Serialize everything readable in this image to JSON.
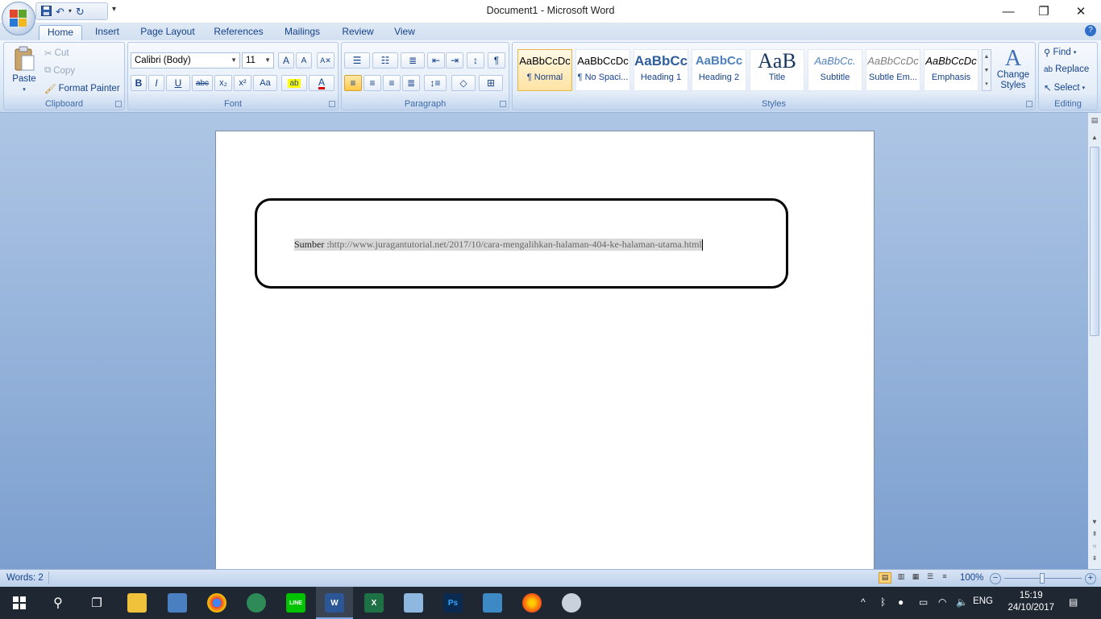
{
  "window": {
    "title": "Document1 - Microsoft Word",
    "minimize": "—",
    "restore": "❐",
    "close": "✕"
  },
  "qat": {
    "more": "▾"
  },
  "tabs": [
    "Home",
    "Insert",
    "Page Layout",
    "References",
    "Mailings",
    "Review",
    "View"
  ],
  "clipboard": {
    "label": "Clipboard",
    "paste": "Paste",
    "cut": "Cut",
    "copy": "Copy",
    "format_painter": "Format Painter"
  },
  "font": {
    "label": "Font",
    "family": "Calibri (Body)",
    "size": "11",
    "bold": "B",
    "italic": "I",
    "underline": "U",
    "strike": "abc",
    "subscript": "x₂",
    "superscript": "x²",
    "change_case": "Aa",
    "grow": "A",
    "shrink": "A"
  },
  "paragraph": {
    "label": "Paragraph",
    "show_marks": "¶"
  },
  "styles": {
    "label": "Styles",
    "items": [
      {
        "preview": "AaBbCcDc",
        "name": "¶ Normal"
      },
      {
        "preview": "AaBbCcDc",
        "name": "¶ No Spaci..."
      },
      {
        "preview": "AaBbCc",
        "name": "Heading 1"
      },
      {
        "preview": "AaBbCc",
        "name": "Heading 2"
      },
      {
        "preview": "AaB",
        "name": "Title"
      },
      {
        "preview": "AaBbCc.",
        "name": "Subtitle"
      },
      {
        "preview": "AaBbCcDc",
        "name": "Subtle Em..."
      },
      {
        "preview": "AaBbCcDc",
        "name": "Emphasis"
      }
    ],
    "change_styles": [
      "Change",
      "Styles"
    ]
  },
  "editing": {
    "label": "Editing",
    "find": "Find",
    "replace": "Replace",
    "select": "Select"
  },
  "document": {
    "prefix": "Sumber :",
    "link": "http://www.juragantutorial.net/2017/10/cara-mengalihkan-halaman-404-ke-halaman-utama.html"
  },
  "status": {
    "words": "Words: 2",
    "zoom": "100%"
  },
  "taskbar": {
    "lang": "ENG",
    "time": "15:19",
    "date": "24/10/2017"
  },
  "colors": {
    "accent": "#15428b",
    "ribbon_bg": "#dbe7f6",
    "doc_bg": "#8fb0da"
  }
}
